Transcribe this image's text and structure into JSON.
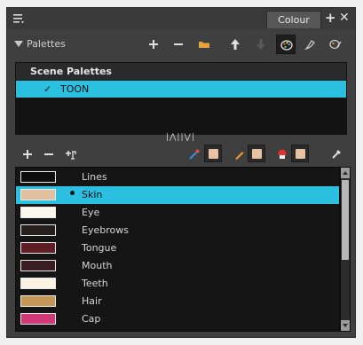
{
  "tabbar": {
    "tab_label": "Colour",
    "menu_icon": "hamburger-menu-icon",
    "add_icon": "plus-icon",
    "close_icon": "close-icon"
  },
  "palettes_toolbar": {
    "label": "Palettes",
    "buttons": [
      "add-palette",
      "remove-palette",
      "import-palette",
      "move-up",
      "move-down",
      "palette-browser",
      "color-picker",
      "link"
    ]
  },
  "scene_palettes": {
    "header": "Scene Palettes",
    "items": [
      {
        "check": "✓",
        "name": "TOON",
        "selected": true
      }
    ]
  },
  "color_toolbar": {
    "buttons": [
      "add-color",
      "remove-color",
      "add-texture",
      "dropper-swatch",
      "pencil-swatch",
      "paint-swatch",
      "eyedropper"
    ],
    "swatch_color": "#e8c2a3"
  },
  "colors": [
    {
      "name": "Lines",
      "swatch": "#0e0e0e",
      "selected": false
    },
    {
      "name": "Skin",
      "swatch": "#e2bf9f",
      "selected": true
    },
    {
      "name": "Eye",
      "swatch": "#fbf6ee",
      "selected": false
    },
    {
      "name": "Eyebrows",
      "swatch": "#261f1c",
      "selected": false
    },
    {
      "name": "Tongue",
      "swatch": "#5e1e23",
      "selected": false
    },
    {
      "name": "Mouth",
      "swatch": "#3a1d24",
      "selected": false
    },
    {
      "name": "Teeth",
      "swatch": "#fbf2e4",
      "selected": false
    },
    {
      "name": "Hair",
      "swatch": "#c49758",
      "selected": false
    },
    {
      "name": "Cap",
      "swatch": "#d13878",
      "selected": false
    }
  ],
  "accent": "#2bc0df"
}
